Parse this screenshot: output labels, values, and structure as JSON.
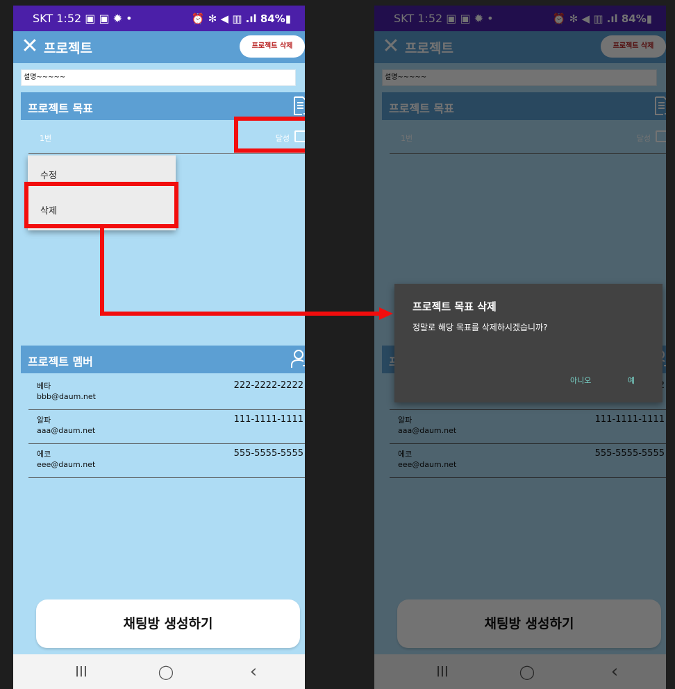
{
  "status_bar": {
    "left_text": "SKT 1:52 ▣ ▣ ✹ •",
    "right_text": "⏰ ✻ ◀ ▥ .ıl 84%▮"
  },
  "app_bar": {
    "title": "프로젝트",
    "delete_button": "프로젝트 삭제"
  },
  "description": "설명~~~~~",
  "goals_section": {
    "title": "프로젝트 목표",
    "icon": "add-document-icon"
  },
  "goal": {
    "name": "1번",
    "status_label": "달성",
    "checked": false
  },
  "context_menu": {
    "edit": "수정",
    "delete": "삭제"
  },
  "members_section": {
    "title": "프로젝트 멤버",
    "icon": "add-user-icon"
  },
  "members": [
    {
      "name": "베타",
      "email": "bbb@daum.net",
      "phone": "222-2222-2222"
    },
    {
      "name": "알파",
      "email": "aaa@daum.net",
      "phone": "111-1111-1111"
    },
    {
      "name": "에코",
      "email": "eee@daum.net",
      "phone": "555-5555-5555"
    }
  ],
  "chat_button": "채팅방 생성하기",
  "nav": {
    "recent": "III",
    "home": "◯",
    "back": "‹"
  },
  "dialog": {
    "title": "프로젝트 목표 삭제",
    "message": "정말로 해당 목표를 삭제하시겠습니까?",
    "no": "아니오",
    "yes": "예"
  },
  "colors": {
    "status_bar": "#4b1fa8",
    "app_bar": "#5c9fd3",
    "background": "#aedcf4",
    "highlight": "#f20d0d",
    "dialog_accent": "#7ad6cc"
  }
}
